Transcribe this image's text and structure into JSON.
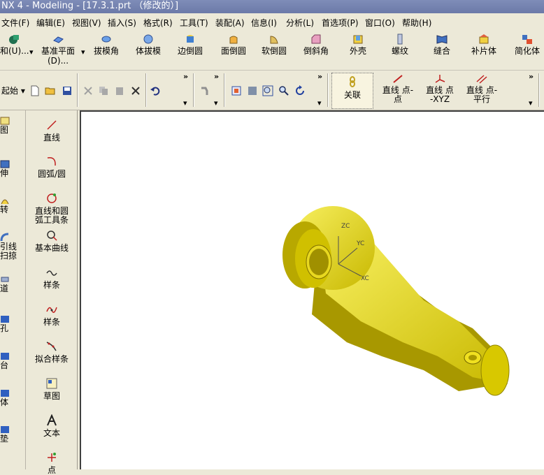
{
  "window": {
    "title": "NX 4 - Modeling - [17.3.1.prt （修改的）]"
  },
  "menu": {
    "items": [
      "文件(F)",
      "编辑(E)",
      "视图(V)",
      "插入(S)",
      "格式(R)",
      "工具(T)",
      "装配(A)",
      "信息(I)",
      "分析(L)",
      "首选项(P)",
      "窗口(O)",
      "帮助(H)"
    ]
  },
  "feature_toolbar": {
    "items": [
      {
        "label": "和(U)..."
      },
      {
        "label": "基准平面\n(D)..."
      },
      {
        "label": "拔模角"
      },
      {
        "label": "体拔模"
      },
      {
        "label": "边倒圆"
      },
      {
        "label": "面倒圆"
      },
      {
        "label": "软倒圆"
      },
      {
        "label": "倒斜角"
      },
      {
        "label": "外壳"
      },
      {
        "label": "螺纹"
      },
      {
        "label": "缝合"
      },
      {
        "label": "补片体"
      },
      {
        "label": "简化体"
      }
    ]
  },
  "standard_toolbar": {
    "start_label": "起始",
    "associative_label": "关联",
    "line_point_point": "直线 点-\n点",
    "line_point_xyz": "直线 点\n-XYZ",
    "line_point_parallel": "直线 点-\n平行"
  },
  "left_palette": {
    "items": [
      "图",
      "伸",
      "转",
      "引线\n扫掠",
      "道",
      "孔",
      "台",
      "体",
      "垫"
    ]
  },
  "curve_palette": {
    "items": [
      "直线",
      "圆弧/圆",
      "直线和圆\n弧工具条",
      "基本曲线",
      "样条",
      "样条",
      "拟合样条",
      "草图",
      "文本",
      "点"
    ]
  },
  "viewport": {
    "axes": {
      "z": "ZC",
      "y": "YC",
      "x": "XC"
    },
    "model_color": "#f0e020"
  },
  "colors": {
    "title_bg": "#7080b0",
    "ui_bg": "#ece9d8",
    "viewport_bg": "#ffffff"
  }
}
